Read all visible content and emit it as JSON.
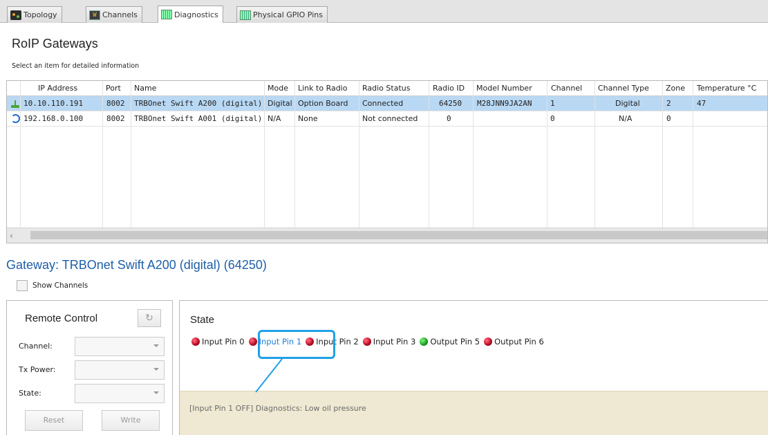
{
  "tabs": [
    {
      "label": "Topology",
      "icon": "topology-icon"
    },
    {
      "label": "Channels",
      "icon": "channels-icon"
    },
    {
      "label": "Diagnostics",
      "icon": "chip-icon"
    },
    {
      "label": "Physical GPIO Pins",
      "icon": "chip-icon"
    }
  ],
  "active_tab": "Diagnostics",
  "gateways": {
    "title": "RoIP Gateways",
    "hint": "Select an item for detailed information",
    "columns": [
      "IP Address",
      "Port",
      "Name",
      "Mode",
      "Link to Radio",
      "Radio Status",
      "Radio ID",
      "Model Number",
      "Channel",
      "Channel Type",
      "Zone",
      "Temperature °C"
    ],
    "rows": [
      {
        "icon": "antenna-icon",
        "ip": "10.10.110.191",
        "port": "8002",
        "name": "TRBOnet Swift A200 (digital)",
        "mode": "Digital",
        "link": "Option Board",
        "status": "Connected",
        "radio_id": "64250",
        "model": "M28JNN9JA2AN",
        "channel": "1",
        "channel_type": "Digital",
        "zone": "2",
        "temperature": "47",
        "selected": true
      },
      {
        "icon": "spinner-icon",
        "ip": "192.168.0.100",
        "port": "8002",
        "name": "TRBOnet Swift A001 (digital)",
        "mode": "N/A",
        "link": "None",
        "status": "Not connected",
        "radio_id": "0",
        "model": "",
        "channel": "0",
        "channel_type": "N/A",
        "zone": "0",
        "temperature": "",
        "selected": false
      }
    ]
  },
  "gateway_detail": {
    "title": "Gateway: TRBOnet Swift A200 (digital) (64250)",
    "show_channels_label": "Show Channels",
    "show_channels_checked": false
  },
  "remote_control": {
    "title": "Remote Control",
    "channel_label": "Channel:",
    "tx_power_label": "Tx Power:",
    "state_label": "State:",
    "reset_label": "Reset",
    "write_label": "Write"
  },
  "state": {
    "title": "State",
    "pins": [
      {
        "label": "Input Pin 0",
        "status": "red"
      },
      {
        "label": "Input Pin 1",
        "status": "red",
        "highlighted": true
      },
      {
        "label": "Input Pin 2",
        "status": "red"
      },
      {
        "label": "Input Pin 3",
        "status": "red"
      },
      {
        "label": "Output Pin 5",
        "status": "green"
      },
      {
        "label": "Output Pin 6",
        "status": "red"
      }
    ],
    "message": "[Input Pin 1 OFF] Diagnostics: Low oil pressure"
  },
  "colors": {
    "selection": "#b9d8f3",
    "gateway_title": "#1f5fa8",
    "callout": "#1fa0e6",
    "led_red": "#d0102a",
    "led_green": "#22b62a",
    "footer": "#efe8d2"
  }
}
